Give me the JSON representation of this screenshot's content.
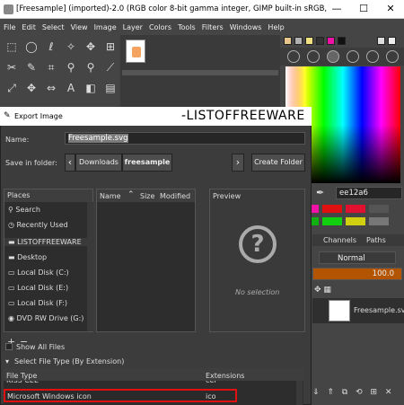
{
  "window": {
    "title": "[Freesample] (imported)-2.0 (RGB color 8-bit gamma integer, GIMP built-in sRGB, 1 layer) 6",
    "minimize": "—",
    "maximize": "☐",
    "close": "✕"
  },
  "menu": [
    "File",
    "Edit",
    "Select",
    "View",
    "Image",
    "Layer",
    "Colors",
    "Tools",
    "Filters",
    "Windows",
    "Help"
  ],
  "dialog": {
    "title": "Export Image",
    "watermark": "-LISTOFFREEWARE",
    "name_label": "Name:",
    "name_value": "Freesample.svg",
    "save_in_label": "Save in folder:",
    "breadcrumb_back": "‹",
    "breadcrumb_downloads": "Downloads",
    "breadcrumb_current": "freesample",
    "breadcrumb_fwd": "›",
    "create_folder": "Create Folder",
    "places_header": "Places",
    "places": [
      "Search",
      "Recently Used",
      "LISTOFFREEWARE",
      "Desktop",
      "Local Disk (C:)",
      "Local Disk (E:)",
      "Local Disk (F:)",
      "DVD RW Drive (G:)"
    ],
    "files_columns": {
      "name": "Name",
      "size": "Size",
      "modified": "Modified"
    },
    "preview_header": "Preview",
    "no_selection": "No selection",
    "show_all_files": "Show All Files",
    "select_file_type": "Select File Type (By Extension)",
    "ft_col_type": "File Type",
    "ft_col_ext": "Extensions",
    "ft_partial_type": "KISS CEL",
    "ft_partial_ext": "cel",
    "ft_selected_type": "Microsoft Windows icon",
    "ft_selected_ext": "ico",
    "add_btn": "+",
    "remove_btn": "−"
  },
  "right": {
    "hex": "ee12a6",
    "channels_tab": "Channels",
    "paths_tab": "Paths",
    "mode": "Normal",
    "opacity": "100.0",
    "layer_name": "Freesample.svg"
  },
  "colors": {
    "accent": "#ee12a6",
    "selected_border": "#e01010"
  }
}
